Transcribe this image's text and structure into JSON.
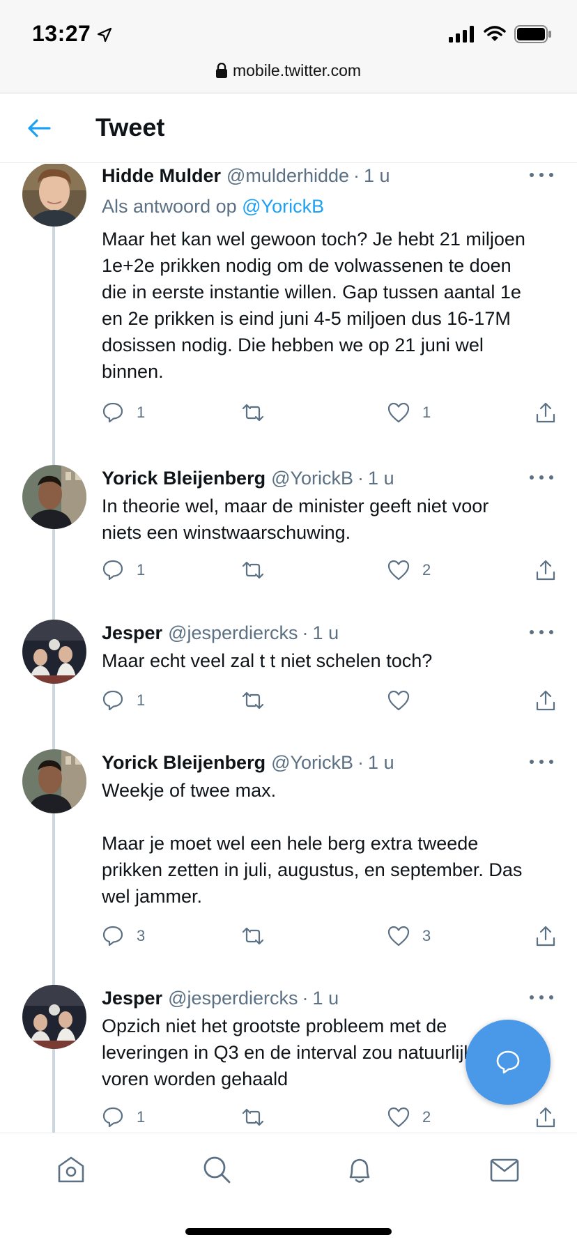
{
  "status_bar": {
    "time": "13:27"
  },
  "url_bar": {
    "url": "mobile.twitter.com"
  },
  "header": {
    "title": "Tweet"
  },
  "tweets": [
    {
      "name": "Hidde Mulder",
      "handle": "@mulderhidde",
      "separator": "·",
      "time": "1 u",
      "reply_to_prefix": "Als antwoord op",
      "reply_to_handle": "@YorickB",
      "text": "Maar het kan wel gewoon toch? Je hebt 21 miljoen\n1e+2e prikken nodig om de volwassenen te doen\ndie in eerste instantie willen. Gap tussen aantal 1e\nen 2e prikken is eind juni 4-5 miljoen dus 16-17M\ndosissen nodig. Die hebben we op 21 juni wel\nbinnen.",
      "replies": "1",
      "retweets": "",
      "likes": "1"
    },
    {
      "name": "Yorick Bleijenberg",
      "handle": "@YorickB",
      "separator": "·",
      "time": "1 u",
      "text": "In theorie wel, maar de minister geeft niet voor\nniets een winstwaarschuwing.",
      "replies": "1",
      "retweets": "",
      "likes": "2"
    },
    {
      "name": "Jesper",
      "handle": "@jesperdiercks",
      "separator": "·",
      "time": "1 u",
      "text": "Maar echt veel zal t t niet schelen toch?",
      "replies": "1",
      "retweets": "",
      "likes": ""
    },
    {
      "name": "Yorick Bleijenberg",
      "handle": "@YorickB",
      "separator": "·",
      "time": "1 u",
      "text": "Weekje of twee max.\n\nMaar je moet wel een hele berg extra tweede\nprikken zetten in juli, augustus, en september. Das\nwel jammer.",
      "replies": "3",
      "retweets": "",
      "likes": "3"
    },
    {
      "name": "Jesper",
      "handle": "@jesperdiercks",
      "separator": "·",
      "time": "1 u",
      "text": "Opzich niet het grootste probleem met de\nleveringen in Q3 en de interval zou natuurlijk naar\nvoren worden gehaald",
      "replies": "1",
      "retweets": "",
      "likes": "2"
    }
  ],
  "colors": {
    "accent": "#1da1f2",
    "fab": "#4a99e9",
    "secondary_text": "#5b7083",
    "thread_line": "#ccd6dd"
  },
  "icons": {
    "back": "arrow-left-icon",
    "reply": "speech-bubble-icon",
    "retweet": "retweet-icon",
    "like": "heart-icon",
    "share": "share-icon",
    "compose": "compose-reply-icon",
    "home": "home-icon",
    "search": "search-icon",
    "notifications": "bell-icon",
    "messages": "envelope-icon"
  }
}
